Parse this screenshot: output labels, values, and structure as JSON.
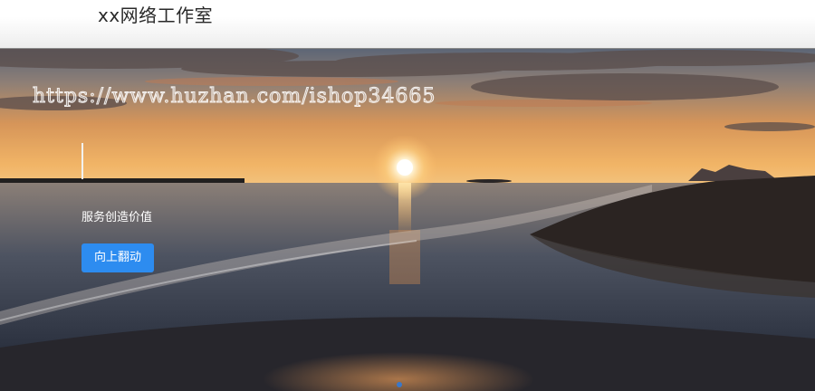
{
  "header": {
    "brand": "xx网络工作室"
  },
  "hero": {
    "watermark": "https://www.huzhan.com/ishop34665",
    "slogan": "服务创造价值",
    "cta_label": "向上翻动"
  },
  "colors": {
    "accent": "#2d8cf0",
    "topbar": "#ffffff",
    "text_dark": "#2a2a2a"
  }
}
